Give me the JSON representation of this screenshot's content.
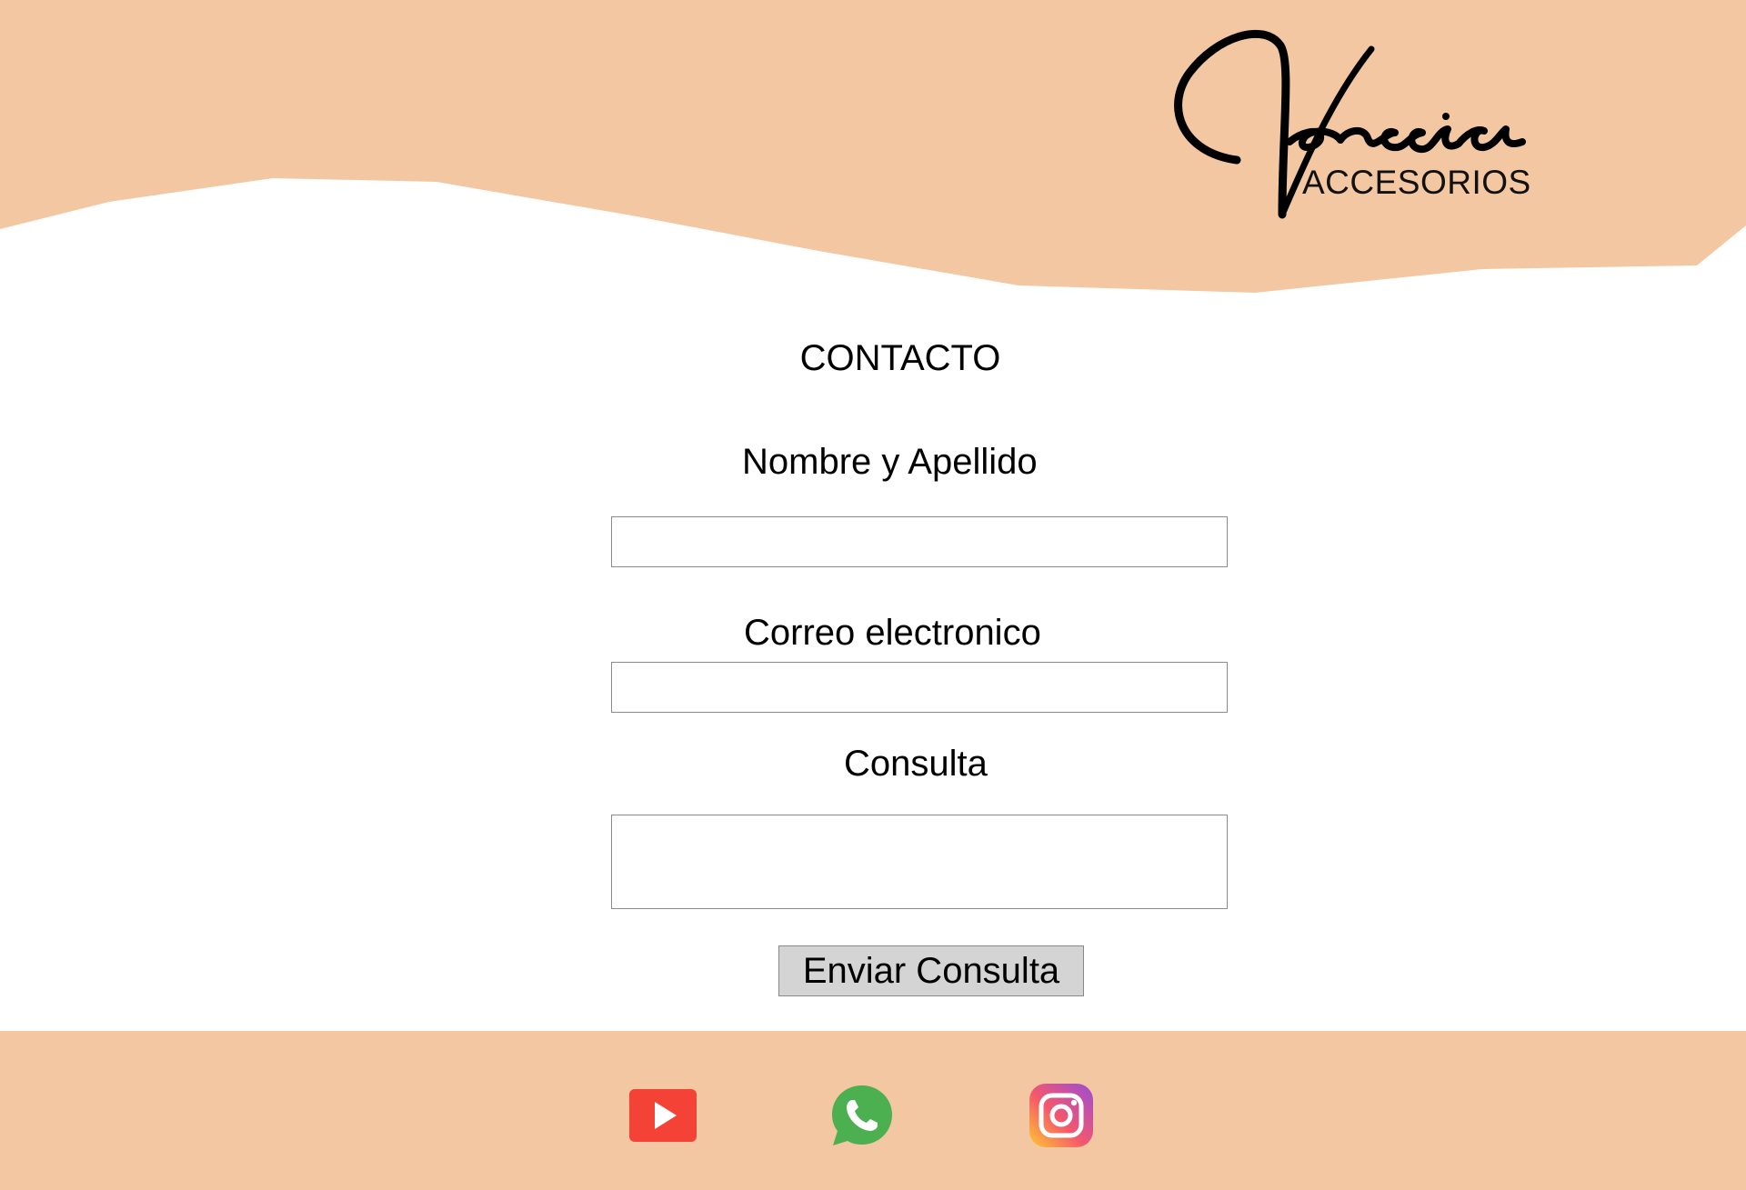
{
  "brand": {
    "script_name": "Venecia",
    "subtitle": "ACCESORIOS"
  },
  "colors": {
    "accent": "#f2c7a2",
    "button_bg": "#d4d4d4",
    "youtube": "#f44336",
    "whatsapp": "#4caf50"
  },
  "form": {
    "title": "CONTACTO",
    "name_label": "Nombre y Apellido",
    "name_value": "",
    "email_label": "Correo electronico",
    "email_value": "",
    "query_label": "Consulta",
    "query_value": "",
    "submit_label": "Enviar Consulta"
  },
  "footer": {
    "social_icons": [
      "youtube-icon",
      "whatsapp-icon",
      "instagram-icon"
    ]
  }
}
